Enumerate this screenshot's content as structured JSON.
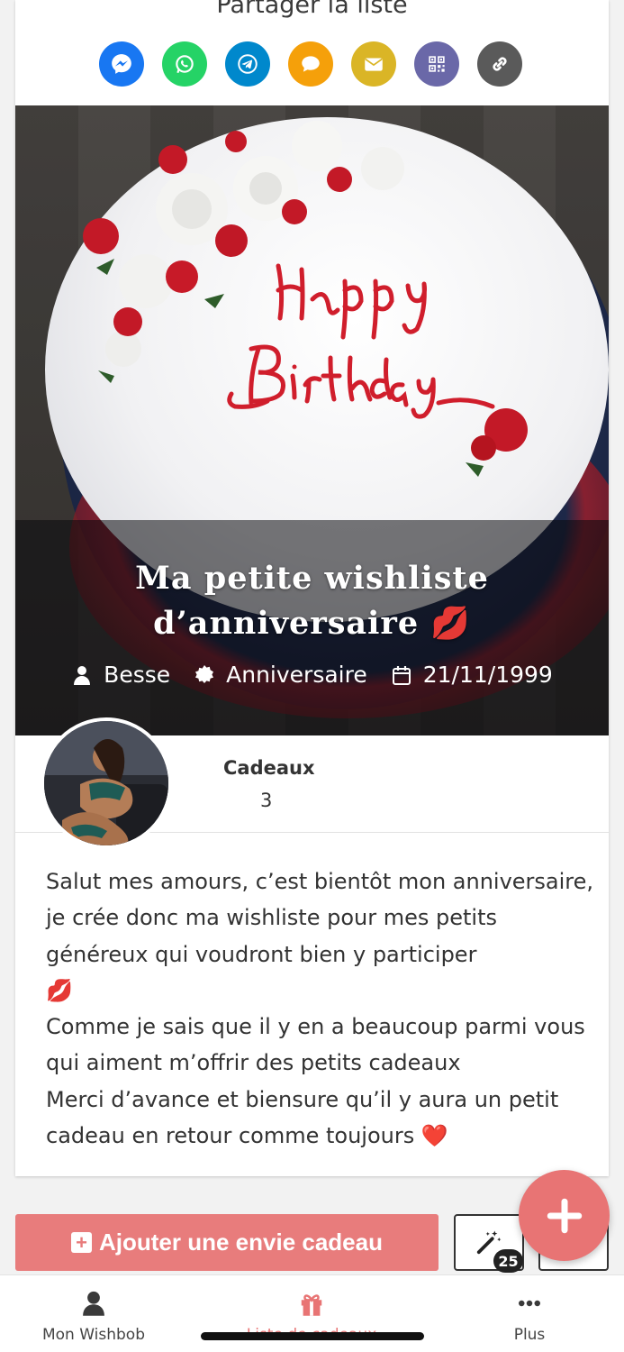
{
  "share": {
    "title": "Partager la liste",
    "buttons": [
      {
        "name": "messenger",
        "color": "#1877f2"
      },
      {
        "name": "whatsapp",
        "color": "#25d366"
      },
      {
        "name": "telegram",
        "color": "#0088cc"
      },
      {
        "name": "sms",
        "color": "#f5a00a"
      },
      {
        "name": "email",
        "color": "#dab526"
      },
      {
        "name": "qr-code",
        "color": "#6a68a8"
      },
      {
        "name": "link",
        "color": "#5a5a5a"
      }
    ]
  },
  "hero": {
    "title_line1": "Ma petite wishliste",
    "title_line2": "d’anniversaire 💋",
    "owner": "Besse",
    "occasion": "Anniversaire",
    "date": "21/11/1999"
  },
  "stats": {
    "label": "Cadeaux",
    "value": "3"
  },
  "description": "Salut mes amours, c’est bientôt mon anniversaire, je crée donc ma wishliste pour mes petits généreux qui voudront bien y participer\n💋\nComme je sais que il y en a beaucoup parmi vous qui aiment m’offrir des petits cadeaux\nMerci d’avance et biensure qu’il y aura un petit cadeau en retour comme toujours ❤️",
  "actions": {
    "add_gift_label": "Ajouter une envie cadeau",
    "wand_badge": "25"
  },
  "nav": {
    "left_label": "Mon Wishbob",
    "mid_label": "Liste de cadeaux",
    "right_label": "Plus"
  },
  "colors": {
    "accent": "#e87474",
    "button": "#e87c7c"
  }
}
